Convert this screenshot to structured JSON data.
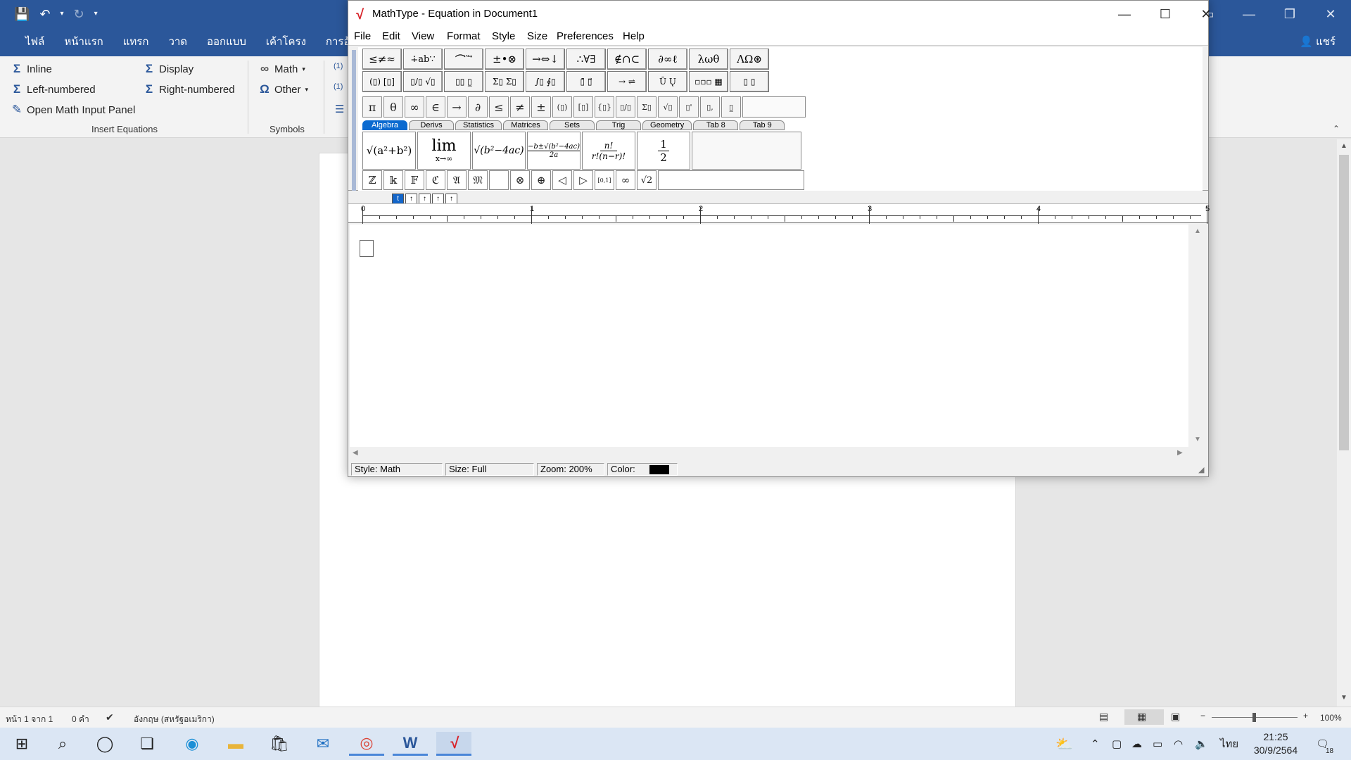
{
  "word": {
    "tabs": [
      "ไฟล์",
      "หน้าแรก",
      "แทรก",
      "วาด",
      "ออกแบบ",
      "เค้าโครง",
      "การอ้างอิง"
    ],
    "share": "แชร์",
    "ribbon": {
      "inline": "Inline",
      "display": "Display",
      "left_numbered": "Left-numbered",
      "right_numbered": "Right-numbered",
      "open_panel": "Open Math Input Panel",
      "math": "Math",
      "other": "Other",
      "group_insert": "Insert Equations",
      "group_symbols": "Symbols",
      "frag1": "(1)",
      "frag2": "(1)"
    },
    "status": {
      "page": "หน้า 1 จาก 1",
      "words": "0 คำ",
      "language": "อังกฤษ (สหรัฐอเมริกา)",
      "zoom": "100%"
    }
  },
  "taskbar": {
    "lang": "ไทย",
    "time": "21:25",
    "date": "30/9/2564",
    "notif_count": "18"
  },
  "mathtype": {
    "title": "MathType - Equation in Document1",
    "menu": [
      "File",
      "Edit",
      "View",
      "Format",
      "Style",
      "Size",
      "Preferences",
      "Help"
    ],
    "palette_row1": [
      "≤≠≈",
      "∔ab∵",
      "⌒ ⃛ ⃗",
      "±•⊗",
      "→⇔↓",
      "∴∀∃",
      "∉∩⊂",
      "∂∞ℓ",
      "λωθ",
      "ΛΩ⊛"
    ],
    "palette_row2": [
      "(▯) [▯]",
      "▯/▯ √▯",
      "▯▯ ▯̲",
      "Σ▯ Σ▯",
      "∫▯ ∮▯",
      "▯̄ ▯⃗",
      "→ ⇌",
      "Ū Ų",
      "▫▫▫ ▦",
      "▯ ▯"
    ],
    "symbol_row": [
      "π",
      "θ",
      "∞",
      "∈",
      "→",
      "∂",
      "≤",
      "≠",
      "±",
      "(▯)",
      "[▯]",
      "{▯}",
      "▯/▯",
      "Σ▯",
      "√▯",
      "▯'",
      "▯,",
      "▯̲"
    ],
    "tabs": [
      "Algebra",
      "Derivs",
      "Statistics",
      "Matrices",
      "Sets",
      "Trig",
      "Geometry",
      "Tab 8",
      "Tab 9"
    ],
    "templates": {
      "t1": "√(a²+b²)",
      "t2_top": "lim",
      "t2_bottom": "x→∞",
      "t3": "√(b²−4ac)",
      "t4_top": "−b±√(b²−4ac)",
      "t4_bottom": "2a",
      "t5_top": "n!",
      "t5_bottom": "r!(n−r)!",
      "t6_top": "1",
      "t6_bottom": "2"
    },
    "small_row": [
      "ℤ",
      "𝕜",
      "𝔽",
      "ℭ",
      "𝔄",
      "𝔐",
      "",
      "⊗",
      "⊕",
      "◁",
      "▷",
      "[0,1]",
      "∞",
      "√2"
    ],
    "nudge": [
      "t",
      "↑",
      "↑",
      "↑",
      "↑"
    ],
    "ruler": [
      "0",
      "1",
      "2",
      "3",
      "4",
      "5"
    ],
    "status": {
      "style": "Style: Math",
      "size": "Size: Full",
      "zoom": "Zoom: 200%",
      "color_label": "Color:"
    },
    "colors": {
      "accent": "#0b6ad0",
      "logo": "#d8232a",
      "swatch": "#000000"
    }
  }
}
